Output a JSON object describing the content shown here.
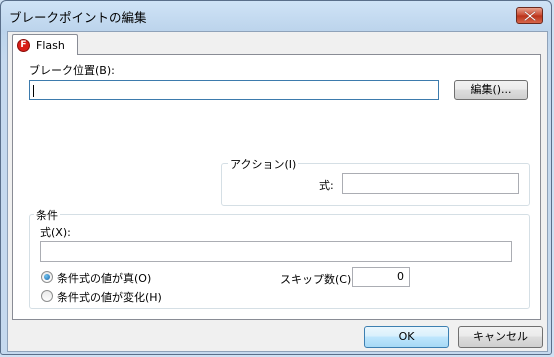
{
  "window": {
    "title": "ブレークポイントの編集",
    "close_icon": "close-icon"
  },
  "tab": {
    "label": "Flash",
    "icon": "flash-icon",
    "icon_glyph": "F",
    "icon_color": "#d91e18"
  },
  "breakpoint": {
    "label": "ブレーク位置(B):",
    "value": "",
    "edit_button": "編集()..."
  },
  "action": {
    "group_title": "アクション(I)",
    "expression_label": "式:",
    "expression_value": ""
  },
  "condition": {
    "group_title": "条件",
    "expression_label": "式(X):",
    "expression_value": "",
    "option_true": "条件式の値が真(O)",
    "option_changed": "条件式の値が変化(H)",
    "selected_option": "条件式の値が真(O)",
    "skip_label": "スキップ数(C):",
    "skip_value": "0"
  },
  "footer": {
    "ok": "OK",
    "cancel": "キャンセル"
  }
}
